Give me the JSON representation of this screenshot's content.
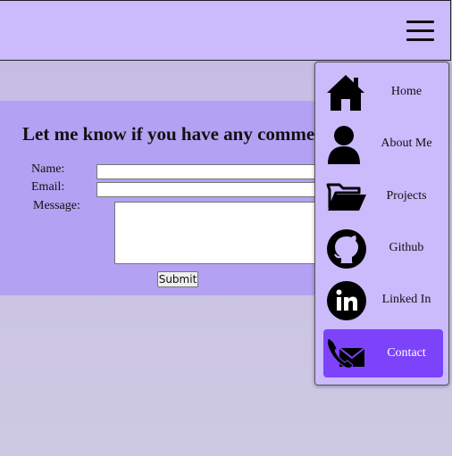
{
  "form": {
    "title": "Let me know if you have any comments",
    "name_label": "Name:",
    "email_label": "Email:",
    "message_label": "Message:",
    "name_value": "",
    "email_value": "",
    "message_value": "",
    "submit_label": "Submit"
  },
  "menu": {
    "items": [
      {
        "label": "Home",
        "icon": "home-icon"
      },
      {
        "label": "About Me",
        "icon": "person-icon"
      },
      {
        "label": "Projects",
        "icon": "folder-icon"
      },
      {
        "label": "Github",
        "icon": "github-icon"
      },
      {
        "label": "Linked In",
        "icon": "linkedin-icon"
      },
      {
        "label": "Contact",
        "icon": "contact-icon",
        "active": true
      }
    ]
  },
  "colors": {
    "topbar": "#cbbafc",
    "form_panel": "#b3a1f3",
    "menu_active": "#7c43fb"
  }
}
